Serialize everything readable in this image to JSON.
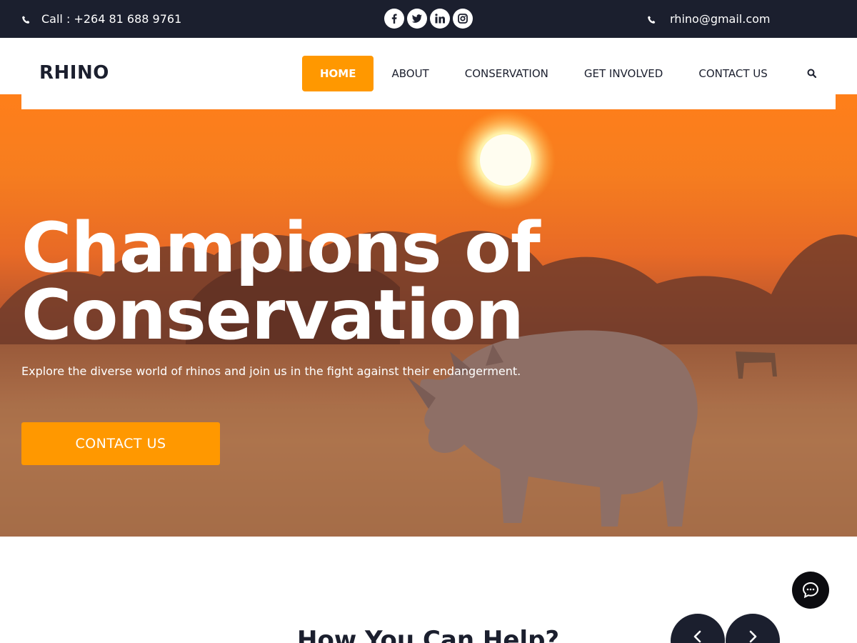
{
  "topbar": {
    "phone_text": "Call : +264 81 688 9761",
    "email_text": "rhino@gmail.com",
    "socials": [
      "facebook-icon",
      "twitter-icon",
      "linkedin-icon",
      "instagram-icon"
    ]
  },
  "header": {
    "logo": "RHINO",
    "nav": [
      "HOME",
      "ABOUT",
      "CONSERVATION",
      "GET INVOLVED",
      "CONTACT US"
    ],
    "active_nav": "HOME"
  },
  "hero": {
    "title_line1": "Champions of",
    "title_line2": "Conservation",
    "subtitle": "Explore the diverse world of rhinos and join us in the fight against their endangerment.",
    "button": "CONTACT US"
  },
  "section": {
    "title": "How You Can Help?"
  },
  "colors": {
    "accent": "#ff9800",
    "dark": "#1b1f2e",
    "white": "#ffffff"
  }
}
